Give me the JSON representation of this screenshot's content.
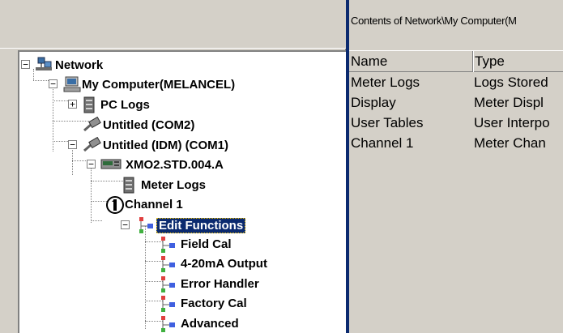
{
  "right_pane": {
    "path_label": "Contents of Network\\My Computer(M",
    "columns": {
      "name": "Name",
      "type": "Type"
    },
    "rows": [
      {
        "name": "Meter Logs",
        "type": "Logs Stored"
      },
      {
        "name": "Display",
        "type": "Meter Displ"
      },
      {
        "name": "User Tables",
        "type": "User Interpo"
      },
      {
        "name": "Channel 1",
        "type": "Meter Chan"
      }
    ]
  },
  "tree": {
    "nodes": [
      {
        "label": "Network",
        "icon": "network-icon",
        "expander": "−"
      },
      {
        "label": "My Computer(MELANCEL)",
        "icon": "computer-icon",
        "expander": "−"
      },
      {
        "label": "PC Logs",
        "icon": "log-storage-icon",
        "expander": "+"
      },
      {
        "label": "Untitled (COM2)",
        "icon": "serial-cable-icon"
      },
      {
        "label": "Untitled (IDM) (COM1)",
        "icon": "serial-cable-icon",
        "expander": "−"
      },
      {
        "label": "XMO2.STD.004.A",
        "icon": "meter-device-icon",
        "expander": "−"
      },
      {
        "label": "Meter Logs",
        "icon": "log-storage-icon"
      },
      {
        "label": "Channel 1",
        "icon": "channel-1-icon"
      },
      {
        "label": "Edit Functions",
        "icon": "function-tree-icon",
        "expander": "−"
      },
      {
        "label": "Field Cal",
        "icon": "function-tree-icon"
      },
      {
        "label": "4-20mA Output",
        "icon": "function-tree-icon"
      },
      {
        "label": "Error Handler",
        "icon": "function-tree-icon"
      },
      {
        "label": "Factory Cal",
        "icon": "function-tree-icon"
      },
      {
        "label": "Advanced",
        "icon": "function-tree-icon"
      }
    ]
  },
  "colors": {
    "selection": "#0b2a6f",
    "panel": "#d4d0c8"
  }
}
